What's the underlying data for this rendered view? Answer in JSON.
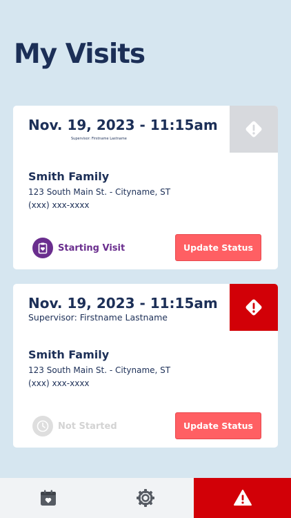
{
  "header": {
    "title": "My Visits"
  },
  "visits": [
    {
      "date": "Nov. 19, 2023 - 11:15am",
      "supervisor": "Supervisor: Firstname Lastname",
      "family": "Smith Family",
      "address": "123 South Main St. - Cityname, ST",
      "phone": "(xxx) xxx-xxxx",
      "alert_icon": "exclamation-diamond-icon",
      "alert_color": "#d7d9dd",
      "status_label": "Starting Visit",
      "status_icon": "clipboard-heart-icon",
      "status_color": "#6a2e8e",
      "button_label": "Update Status"
    },
    {
      "date": "Nov. 19, 2023 - 11:15am",
      "supervisor": "Supervisor: Firstname Lastname",
      "family": "Smith Family",
      "address": "123 South Main St. - Cityname, ST",
      "phone": "(xxx) xxx-xxxx",
      "alert_icon": "exclamation-diamond-icon",
      "alert_color": "#d20007",
      "status_label": "Not Started",
      "status_icon": "clock-icon",
      "status_color": "#d3d3d3",
      "button_label": "Update Status"
    }
  ],
  "tabbar": {
    "tabs": [
      {
        "icon": "calendar-heart-icon",
        "active": false
      },
      {
        "icon": "gear-icon",
        "active": false
      },
      {
        "icon": "warning-triangle-icon",
        "active": true
      }
    ],
    "active_color": "#d20007"
  },
  "colors": {
    "background": "#d6e6f0",
    "navy": "#1c2f57",
    "button": "#ff5f63"
  }
}
